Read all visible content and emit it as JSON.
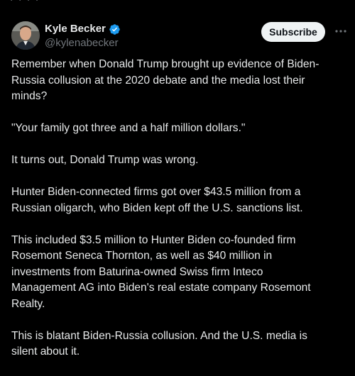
{
  "tweet": {
    "top_remnant": "· · · ·",
    "author": {
      "display_name": "Kyle Becker",
      "handle": "@kylenabecker",
      "verified": true
    },
    "subscribe_label": "Subscribe",
    "more_label": "···",
    "paragraphs": [
      "Remember when Donald Trump brought up evidence of Biden-\nRussia collusion at the 2020 debate and the media lost their\nminds?",
      "\"Your family got three and a half million dollars.\"",
      "It turns out, Donald Trump was wrong.",
      "Hunter Biden-connected firms got over $43.5 million from a\nRussian oligarch, who Biden kept off the U.S. sanctions list.",
      "This included $3.5 million to Hunter Biden co-founded firm\nRosemont Seneca Thornton, as well as $40 million in\ninvestments from Baturina-owned Swiss firm Inteco\nManagement AG into Biden's real estate company Rosemont\nRealty.",
      "This is blatant Biden-Russia collusion. And the U.S. media is\nsilent about it."
    ]
  },
  "colors": {
    "background": "#000000",
    "text_primary": "#e7e9ea",
    "text_secondary": "#71767b",
    "verified_blue": "#1d9bf0",
    "button_bg": "#eff3f4",
    "button_text": "#0f1419"
  },
  "icons": {
    "verified": "verified-badge-icon",
    "more": "more-horizontal-icon"
  }
}
